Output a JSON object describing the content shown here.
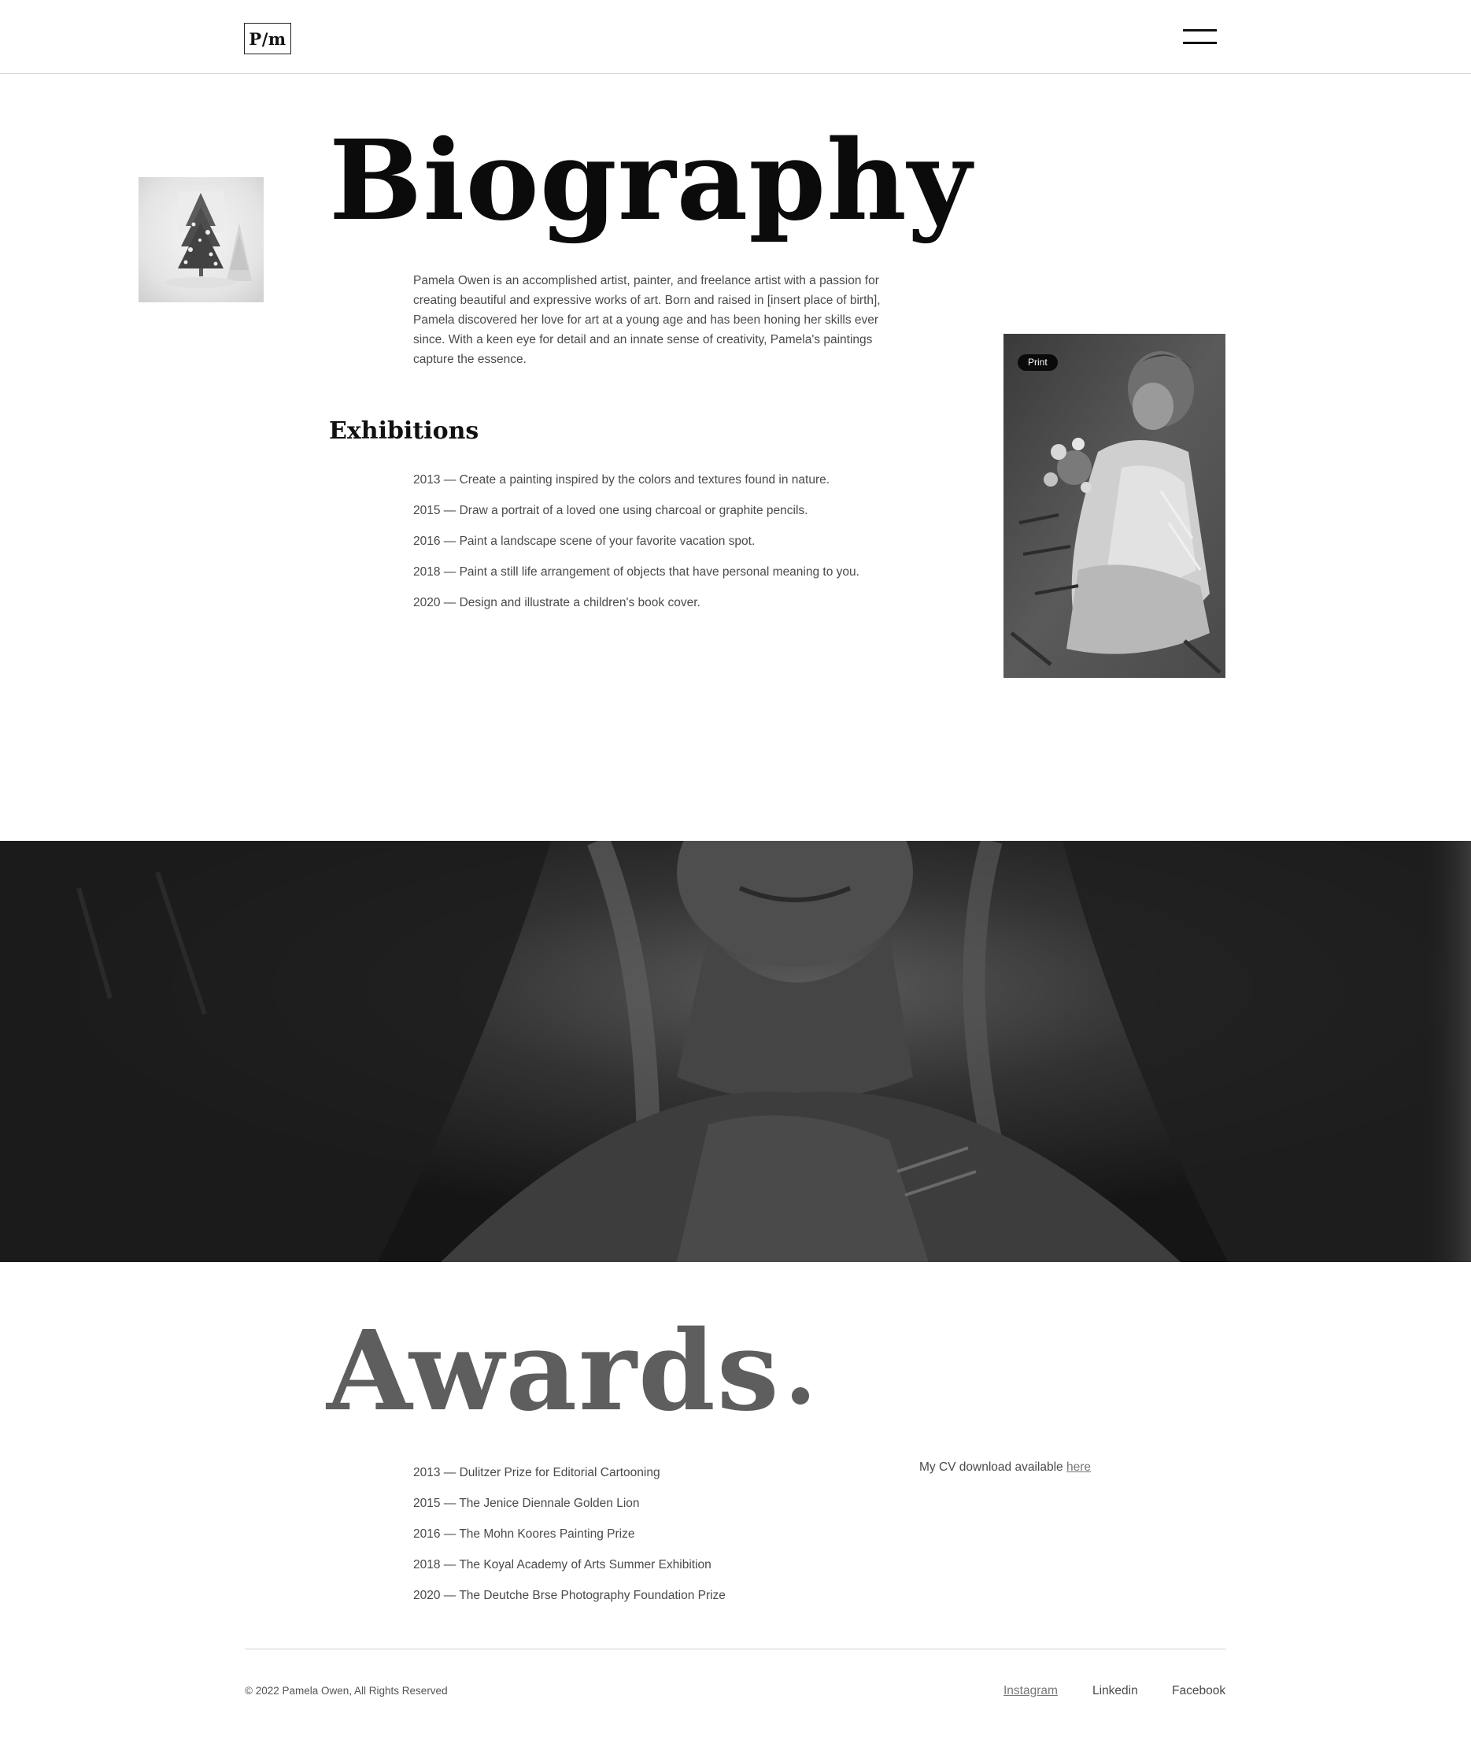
{
  "header": {
    "logo_text": "P/m",
    "menu_icon": "hamburger-menu-icon"
  },
  "biography": {
    "title": "Biography",
    "text": "Pamela Owen is an accomplished artist, painter, and freelance artist with a passion for creating beautiful and expressive works of art. Born and raised in [insert place of birth], Pamela discovered her love for art at a young age and has been honing her skills ever since. With a keen eye for detail and an innate sense of creativity, Pamela's paintings capture the essence."
  },
  "exhibitions": {
    "title": "Exhibitions",
    "items": [
      "2013 — Create a painting inspired by the colors and textures found in nature.",
      "2015 — Draw a portrait of a loved one using charcoal or graphite pencils.",
      "2016 — Paint a landscape scene of your favorite vacation spot.",
      "2018 — Paint a still life arrangement of objects that have personal meaning to you.",
      "2020 — Design and illustrate a children's book cover."
    ]
  },
  "side_art": {
    "badge": "Print"
  },
  "awards": {
    "title": "Awards",
    "items": [
      "2013 — Dulitzer Prize for Editorial Cartooning",
      "2015 — The Jenice Diennale Golden Lion",
      "2016 — The Mohn Koores Painting Prize",
      "2018 — The Koyal Academy of Arts Summer Exhibition",
      "2020 — The Deutche Brse Photography Foundation Prize"
    ],
    "cv_text": "My CV download available",
    "cv_link": "here"
  },
  "footer": {
    "copyright": "© 2022 Pamela Owen, All Rights Reserved",
    "links": {
      "instagram": "Instagram",
      "linkedin": "Linkedin",
      "facebook": "Facebook"
    }
  },
  "colors": {
    "text_primary": "#0b0b0b",
    "text_body": "#4a4a4a",
    "awards_title": "#5e5e5e",
    "banner_dark": "#1a1a1a"
  }
}
